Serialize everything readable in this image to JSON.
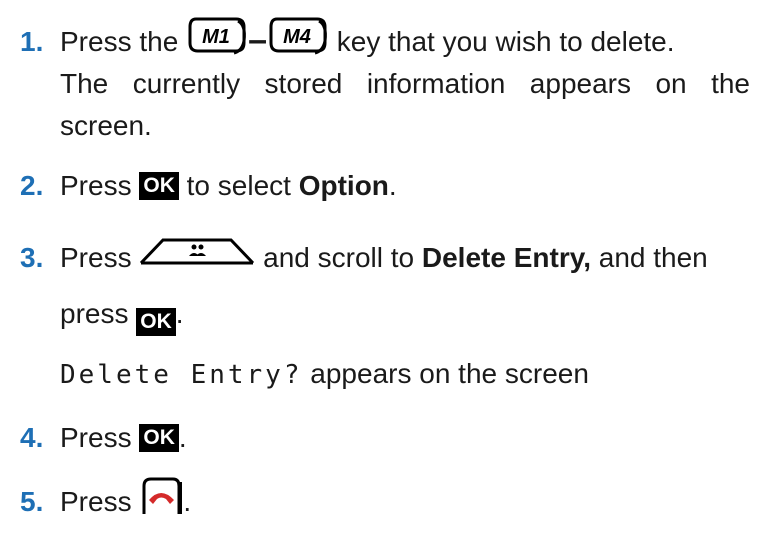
{
  "steps": [
    {
      "number": "1.",
      "line1_pre": "Press the",
      "key_m1": "M1",
      "dash": "–",
      "key_m4": "M4",
      "line1_post": "key that you wish to delete.",
      "line2": "The currently stored information appears on the",
      "line3": "screen."
    },
    {
      "number": "2.",
      "pre": "Press",
      "ok_label": "OK",
      "mid": "to select",
      "bold": "Option",
      "post": "."
    },
    {
      "number": "3.",
      "pre": "Press",
      "nav_icon": "contacts-nav-key-icon",
      "mid": "and scroll to",
      "bold": "Delete Entry,",
      "post": "and then",
      "line2_pre": "press",
      "ok_label": "OK",
      "line2_post": "."
    },
    {
      "display_text": "Delete Entry?",
      "after": "appears on the screen"
    },
    {
      "number": "4.",
      "pre": "Press",
      "ok_label": "OK",
      "post": "."
    },
    {
      "number": "5.",
      "pre": "Press",
      "end_icon": "end-call-key-icon",
      "post": "."
    }
  ],
  "colors": {
    "step_number": "#1e6fb5",
    "ok_key_bg": "#000000",
    "end_call_red": "#d42a2a"
  }
}
